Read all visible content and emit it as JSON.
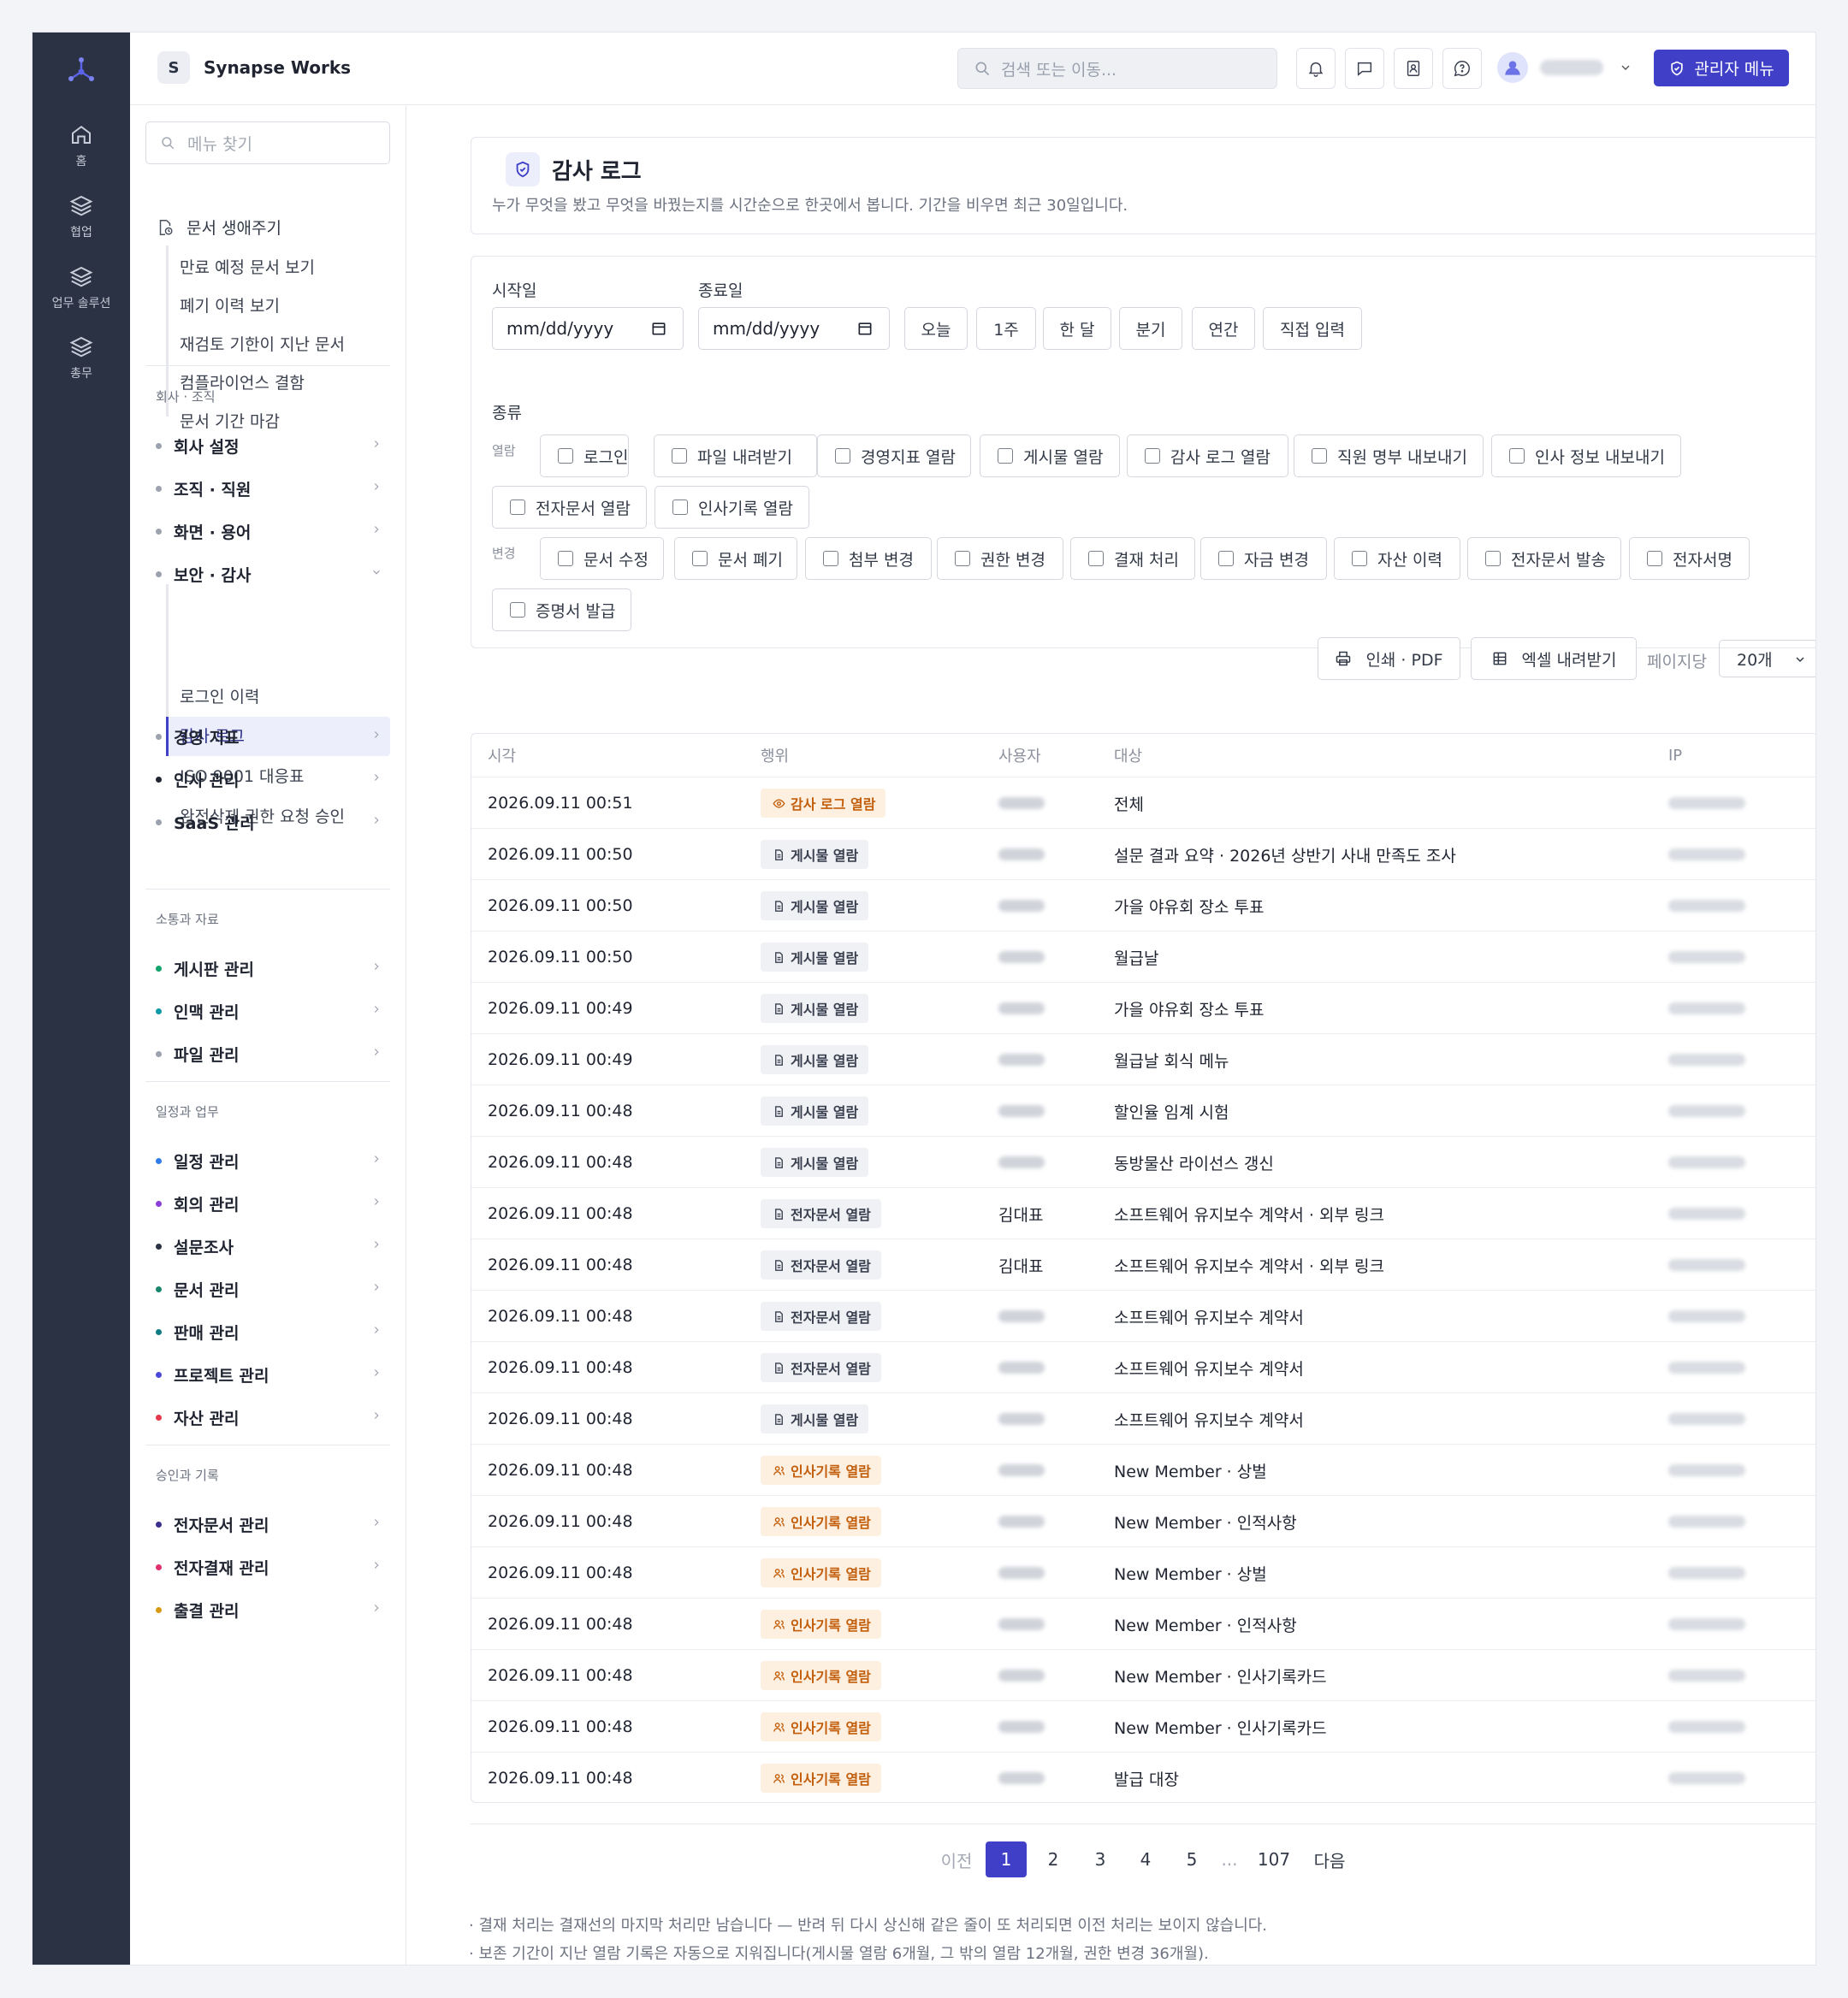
{
  "topbar": {
    "brand_letter": "S",
    "brand_name": "Synapse Works",
    "search_placeholder": "검색 또는 이동...",
    "admin_label": "관리자 메뉴"
  },
  "rail": {
    "items": [
      {
        "label": "홈",
        "icon": "home-icon"
      },
      {
        "label": "협업",
        "icon": "layers-icon"
      },
      {
        "label": "업무 솔루션",
        "icon": "layers-icon"
      },
      {
        "label": "총무",
        "icon": "layers-icon"
      }
    ]
  },
  "sidebar": {
    "search_placeholder": "메뉴 찾기",
    "top_group": "문서 생애주기",
    "top_sub": [
      "만료 예정 문서 보기",
      "폐기 이력 보기",
      "재검토 기한이 지난 문서",
      "컴플라이언스 결함",
      "문서 기간 마감"
    ],
    "sections": [
      {
        "title": "회사 · 조직",
        "items": [
          {
            "label": "회사 설정",
            "color": "#9ca3af"
          },
          {
            "label": "조직 · 직원",
            "color": "#9ca3af"
          },
          {
            "label": "화면 · 용어",
            "color": "#9ca3af"
          },
          {
            "label": "보안 · 감사",
            "color": "#9ca3af",
            "expanded": true,
            "children": [
              "로그인 이력",
              "감사 로그",
              "ISO 9001 대응표",
              "완전삭제 권한 요청 승인"
            ],
            "active_child": "감사 로그"
          },
          {
            "label": "경영 지표",
            "color": "#9ca3af"
          },
          {
            "label": "인사 관리",
            "color": "#1f2430"
          },
          {
            "label": "SaaS 관리",
            "color": "#9ca3af"
          }
        ]
      },
      {
        "title": "소통과 자료",
        "items": [
          {
            "label": "게시판 관리",
            "color": "#10a36a"
          },
          {
            "label": "인맥 관리",
            "color": "#0f9aa8"
          },
          {
            "label": "파일 관리",
            "color": "#9ca3af"
          }
        ]
      },
      {
        "title": "일정과 업무",
        "items": [
          {
            "label": "일정 관리",
            "color": "#2f7be8"
          },
          {
            "label": "회의 관리",
            "color": "#8b3fd6"
          },
          {
            "label": "설문조사",
            "color": "#2b3243"
          },
          {
            "label": "문서 관리",
            "color": "#17866a"
          },
          {
            "label": "판매 관리",
            "color": "#0f7c84"
          },
          {
            "label": "프로젝트 관리",
            "color": "#4b4ad8"
          },
          {
            "label": "자산 관리",
            "color": "#e5394b"
          }
        ]
      },
      {
        "title": "승인과 기록",
        "items": [
          {
            "label": "전자문서 관리",
            "color": "#3a2f8c"
          },
          {
            "label": "전자결재 관리",
            "color": "#e0306f"
          },
          {
            "label": "출결 관리",
            "color": "#d79a12"
          }
        ]
      }
    ]
  },
  "page": {
    "title": "감사 로그",
    "description": "누가 무엇을 봤고 무엇을 바꿨는지를 시간순으로 한곳에서 봅니다. 기간을 비우면 최근 30일입니다."
  },
  "filters": {
    "start_label": "시작일",
    "end_label": "종료일",
    "date_placeholder": "mm/dd/yyyy",
    "quick": [
      "오늘",
      "1주",
      "한 달",
      "분기",
      "연간",
      "직접 입력"
    ],
    "type_label": "종류",
    "view_group": "열람",
    "change_group": "변경",
    "view_types": [
      "로그인",
      "파일 내려받기",
      "경영지표 열람",
      "게시물 열람",
      "감사 로그 열람",
      "직원 명부 내보내기",
      "인사 정보 내보내기",
      "전자문서 열람",
      "인사기록 열람"
    ],
    "change_types": [
      "문서 수정",
      "문서 폐기",
      "첨부 변경",
      "권한 변경",
      "결재 처리",
      "자금 변경",
      "자산 이력",
      "전자문서 발송",
      "전자서명",
      "증명서 발급"
    ]
  },
  "toolbar": {
    "print_label": "인쇄 · PDF",
    "excel_label": "엑셀 내려받기",
    "per_page_label": "페이지당",
    "per_page_value": "20개"
  },
  "table": {
    "headers": [
      "시각",
      "행위",
      "사용자",
      "대상",
      "IP"
    ],
    "rows": [
      {
        "time": "2026.09.11 00:51",
        "action": "감사 로그 열람",
        "kind": "audit",
        "user": "",
        "target": "전체"
      },
      {
        "time": "2026.09.11 00:50",
        "action": "게시물 열람",
        "kind": "doc",
        "user": "",
        "target": "설문 결과 요약 · 2026년 상반기 사내 만족도 조사"
      },
      {
        "time": "2026.09.11 00:50",
        "action": "게시물 열람",
        "kind": "doc",
        "user": "",
        "target": "가을 야유회 장소 투표"
      },
      {
        "time": "2026.09.11 00:50",
        "action": "게시물 열람",
        "kind": "doc",
        "user": "",
        "target": "월급날"
      },
      {
        "time": "2026.09.11 00:49",
        "action": "게시물 열람",
        "kind": "doc",
        "user": "",
        "target": "가을 야유회 장소 투표"
      },
      {
        "time": "2026.09.11 00:49",
        "action": "게시물 열람",
        "kind": "doc",
        "user": "",
        "target": "월급날 회식 메뉴"
      },
      {
        "time": "2026.09.11 00:48",
        "action": "게시물 열람",
        "kind": "doc",
        "user": "",
        "target": "할인율 임계 시험"
      },
      {
        "time": "2026.09.11 00:48",
        "action": "게시물 열람",
        "kind": "doc",
        "user": "",
        "target": "동방물산 라이선스 갱신"
      },
      {
        "time": "2026.09.11 00:48",
        "action": "전자문서 열람",
        "kind": "doc",
        "user": "김대표",
        "target": "소프트웨어 유지보수 계약서 · 외부 링크"
      },
      {
        "time": "2026.09.11 00:48",
        "action": "전자문서 열람",
        "kind": "doc",
        "user": "김대표",
        "target": "소프트웨어 유지보수 계약서 · 외부 링크"
      },
      {
        "time": "2026.09.11 00:48",
        "action": "전자문서 열람",
        "kind": "doc",
        "user": "",
        "target": "소프트웨어 유지보수 계약서"
      },
      {
        "time": "2026.09.11 00:48",
        "action": "전자문서 열람",
        "kind": "doc",
        "user": "",
        "target": "소프트웨어 유지보수 계약서"
      },
      {
        "time": "2026.09.11 00:48",
        "action": "게시물 열람",
        "kind": "doc",
        "user": "",
        "target": "소프트웨어 유지보수 계약서"
      },
      {
        "time": "2026.09.11 00:48",
        "action": "인사기록 열람",
        "kind": "hr",
        "user": "",
        "target": "New Member · 상벌"
      },
      {
        "time": "2026.09.11 00:48",
        "action": "인사기록 열람",
        "kind": "hr",
        "user": "",
        "target": "New Member · 인적사항"
      },
      {
        "time": "2026.09.11 00:48",
        "action": "인사기록 열람",
        "kind": "hr",
        "user": "",
        "target": "New Member · 상벌"
      },
      {
        "time": "2026.09.11 00:48",
        "action": "인사기록 열람",
        "kind": "hr",
        "user": "",
        "target": "New Member · 인적사항"
      },
      {
        "time": "2026.09.11 00:48",
        "action": "인사기록 열람",
        "kind": "hr",
        "user": "",
        "target": "New Member · 인사기록카드"
      },
      {
        "time": "2026.09.11 00:48",
        "action": "인사기록 열람",
        "kind": "hr",
        "user": "",
        "target": "New Member · 인사기록카드"
      },
      {
        "time": "2026.09.11 00:48",
        "action": "인사기록 열람",
        "kind": "hr",
        "user": "",
        "target": "발급 대장"
      }
    ]
  },
  "pagination": {
    "prev": "이전",
    "pages": [
      "1",
      "2",
      "3",
      "4",
      "5"
    ],
    "ellipsis": "...",
    "last": "107",
    "next": "다음",
    "current": "1"
  },
  "notes": [
    "· 결재 처리는 결재선의 마지막 처리만 남습니다 — 반려 뒤 다시 상신해 같은 줄이 또 처리되면 이전 처리는 보이지 않습니다.",
    "· 보존 기간이 지난 열람 기록은 자동으로 지워집니다(게시물 열람 6개월, 그 밖의 열람 12개월, 권한 변경 36개월)."
  ],
  "colors": {
    "accent": "#3f3fc7",
    "rail": "#2b3243",
    "tag_audit_bg": "#fdf0e0",
    "tag_audit_fg": "#c25e0c",
    "tag_doc_bg": "#f0f1f4",
    "tag_doc_fg": "#3a4050"
  }
}
